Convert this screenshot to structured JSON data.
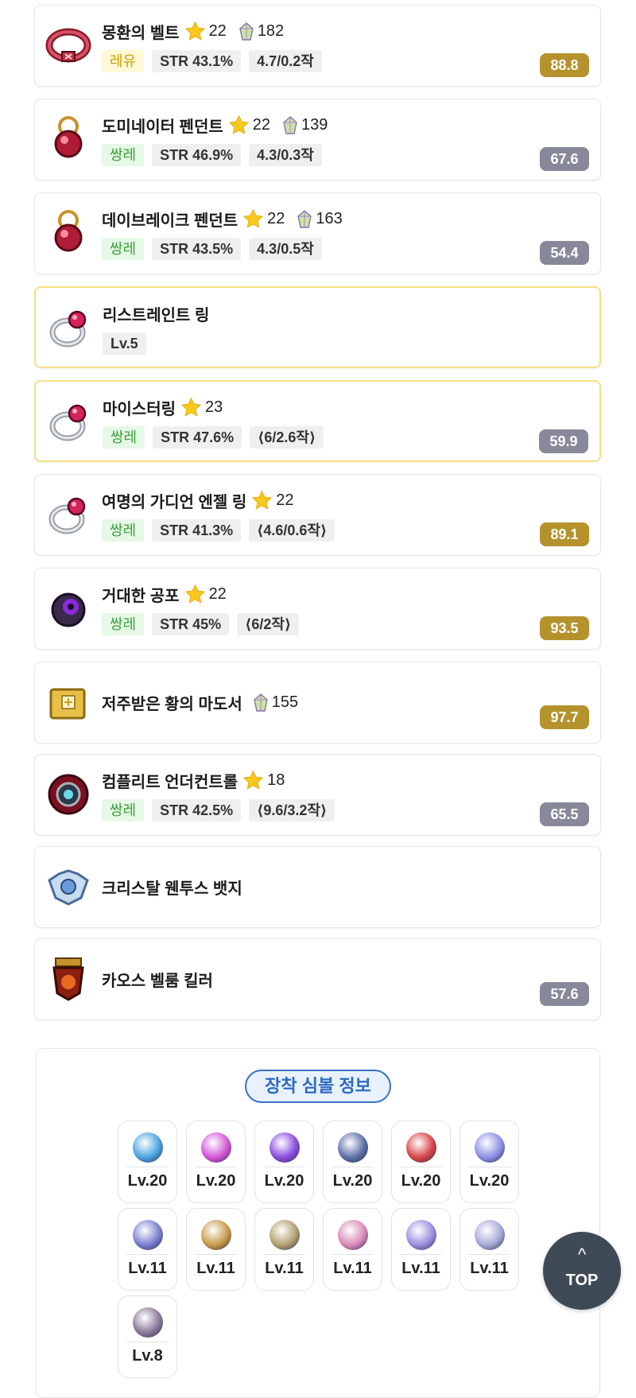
{
  "items": [
    {
      "name": "몽환의 벨트",
      "star": "22",
      "gem": "182",
      "potential": "레유",
      "pot_color": "y",
      "stat": "STR 43.1%",
      "scroll": "4.7/0.2작",
      "score": "88.8",
      "score_color": "gold",
      "icon": "belt-icon"
    },
    {
      "name": "도미네이터 펜던트",
      "star": "22",
      "gem": "139",
      "potential": "쌍레",
      "pot_color": "g",
      "stat": "STR 46.9%",
      "scroll": "4.3/0.3작",
      "score": "67.6",
      "score_color": "gray",
      "icon": "pendant-icon"
    },
    {
      "name": "데이브레이크 펜던트",
      "star": "22",
      "gem": "163",
      "potential": "쌍레",
      "pot_color": "g",
      "stat": "STR 43.5%",
      "scroll": "4.3/0.5작",
      "score": "54.4",
      "score_color": "gray",
      "icon": "pendant-icon"
    },
    {
      "name": "리스트레인트 링",
      "level": "Lv.5",
      "icon": "ring-icon",
      "highlight": true
    },
    {
      "name": "마이스터링",
      "star": "23",
      "potential": "쌍레",
      "pot_color": "g",
      "stat": "STR 47.6%",
      "scroll": "⟨6/2.6작⟩",
      "score": "59.9",
      "score_color": "gray",
      "icon": "ring-icon",
      "highlight": true
    },
    {
      "name": "여명의 가디언 엔젤 링",
      "star": "22",
      "potential": "쌍레",
      "pot_color": "g",
      "stat": "STR 41.3%",
      "scroll": "⟨4.6/0.6작⟩",
      "score": "89.1",
      "score_color": "gold",
      "icon": "ring-icon"
    },
    {
      "name": "거대한 공포",
      "star": "22",
      "potential": "쌍레",
      "pot_color": "g",
      "stat": "STR 45%",
      "scroll": "⟨6/2작⟩",
      "score": "93.5",
      "score_color": "gold",
      "icon": "eye-accessory-icon"
    },
    {
      "name": "저주받은 황의 마도서",
      "gem": "155",
      "score": "97.7",
      "score_color": "gold",
      "icon": "book-icon"
    },
    {
      "name": "컴플리트 언더컨트롤",
      "star": "18",
      "potential": "쌍레",
      "pot_color": "g",
      "stat": "STR 42.5%",
      "scroll": "⟨9.6/3.2작⟩",
      "score": "65.5",
      "score_color": "gray",
      "icon": "emblem-icon"
    },
    {
      "name": "크리스탈 웬투스 뱃지",
      "icon": "badge-icon"
    },
    {
      "name": "카오스 벨룸 킬러",
      "score": "57.6",
      "score_color": "gray",
      "icon": "medal-icon"
    }
  ],
  "symbols": {
    "title": "장착 심볼 정보",
    "arcane": [
      {
        "level": "Lv.20",
        "color": "#4aa3e0"
      },
      {
        "level": "Lv.20",
        "color": "#d356d8"
      },
      {
        "level": "Lv.20",
        "color": "#8a4ee0"
      },
      {
        "level": "Lv.20",
        "color": "#5c6fa8"
      },
      {
        "level": "Lv.20",
        "color": "#d8454a"
      },
      {
        "level": "Lv.20",
        "color": "#8a8fe6"
      }
    ],
    "authentic": [
      {
        "level": "Lv.11",
        "color": "#7a7fd0"
      },
      {
        "level": "Lv.11",
        "color": "#c79a4a"
      },
      {
        "level": "Lv.11",
        "color": "#b2a070"
      },
      {
        "level": "Lv.11",
        "color": "#d88ab8"
      },
      {
        "level": "Lv.11",
        "color": "#9a8fe0"
      },
      {
        "level": "Lv.11",
        "color": "#a8a8d8"
      }
    ],
    "grand": [
      {
        "level": "Lv.8",
        "color": "#8a7a9a"
      }
    ]
  },
  "top_button": {
    "label": "TOP",
    "arrow": "^"
  }
}
